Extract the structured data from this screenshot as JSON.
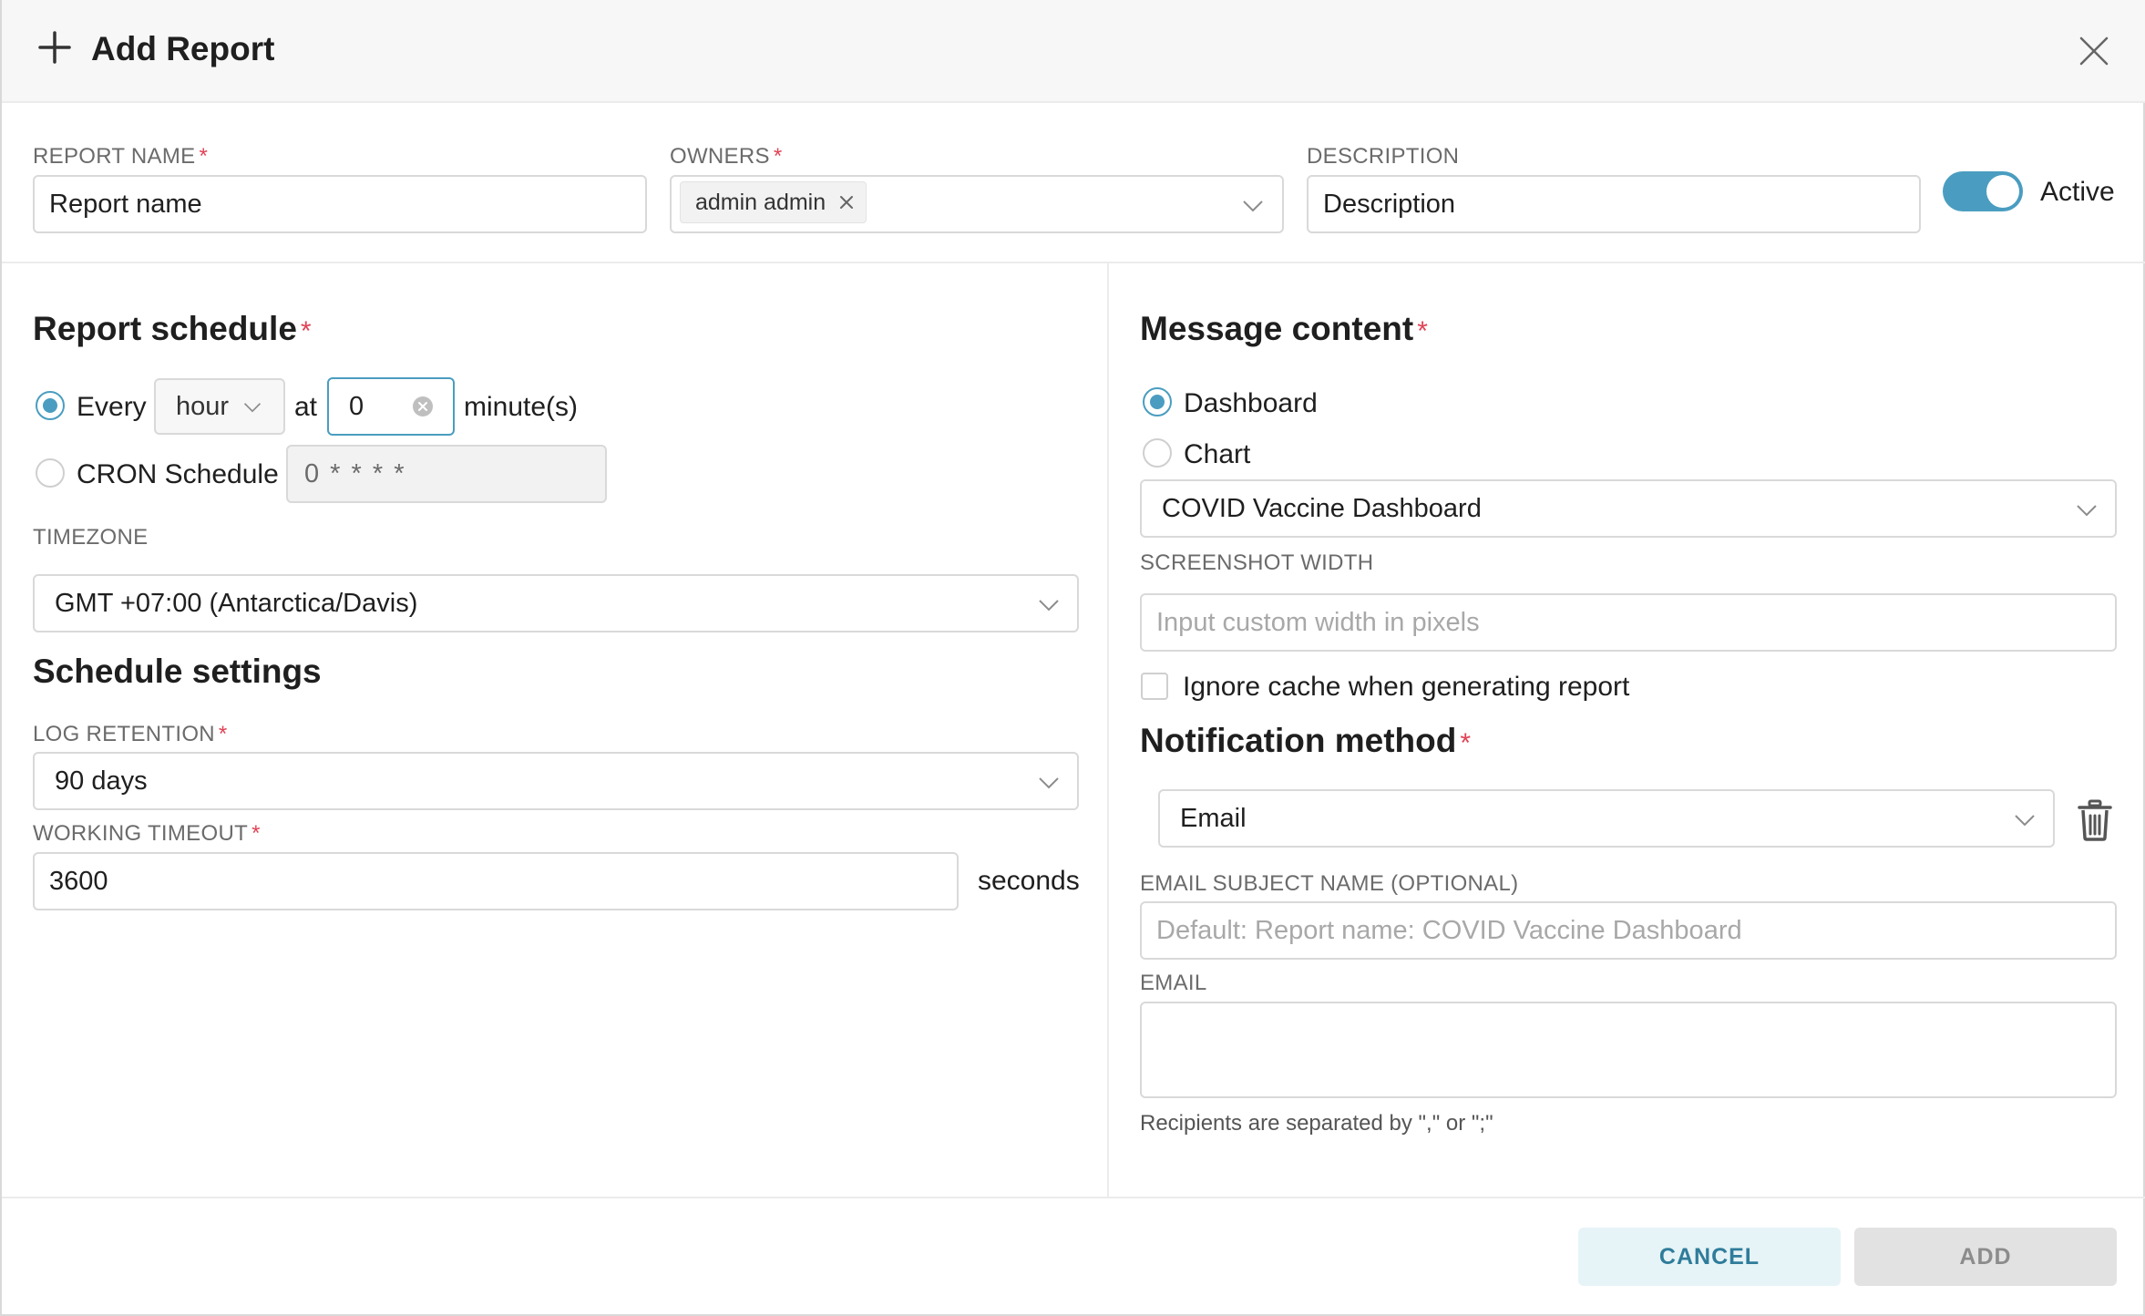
{
  "header": {
    "title": "Add Report"
  },
  "top_row": {
    "report_name_label": "REPORT NAME",
    "report_name_value": "Report name",
    "owners_label": "OWNERS",
    "owners": [
      "admin admin"
    ],
    "description_label": "DESCRIPTION",
    "description_value": "Description",
    "active_label": "Active",
    "active": true
  },
  "schedule": {
    "title": "Report schedule",
    "every_label": "Every",
    "every_unit": "hour",
    "at_label": "at",
    "minute_value": "0",
    "minute_suffix": "minute(s)",
    "cron_label": "CRON Schedule",
    "cron_value": "0 * * * *",
    "selected": "every",
    "timezone_label": "TIMEZONE",
    "timezone_value": "GMT +07:00 (Antarctica/Davis)"
  },
  "schedule_settings": {
    "title": "Schedule settings",
    "log_retention_label": "LOG RETENTION",
    "log_retention_value": "90 days",
    "working_timeout_label": "WORKING TIMEOUT",
    "working_timeout_value": "3600",
    "working_timeout_unit": "seconds"
  },
  "message_content": {
    "title": "Message content",
    "option_dashboard": "Dashboard",
    "option_chart": "Chart",
    "selected": "dashboard",
    "dashboard_value": "COVID Vaccine Dashboard",
    "screenshot_width_label": "SCREENSHOT WIDTH",
    "screenshot_width_placeholder": "Input custom width in pixels",
    "ignore_cache_label": "Ignore cache when generating report",
    "ignore_cache": false
  },
  "notification": {
    "title": "Notification method",
    "method_value": "Email",
    "email_subject_label": "EMAIL SUBJECT NAME (OPTIONAL)",
    "email_subject_placeholder": "Default: Report name: COVID Vaccine Dashboard",
    "email_label": "EMAIL",
    "email_value": "",
    "help_text": "Recipients are separated by \",\" or \";\""
  },
  "footer": {
    "cancel_label": "CANCEL",
    "add_label": "ADD"
  },
  "colors": {
    "accent": "#4a9dc0",
    "required": "#e04355",
    "cancel_text": "#2f7c9a"
  }
}
